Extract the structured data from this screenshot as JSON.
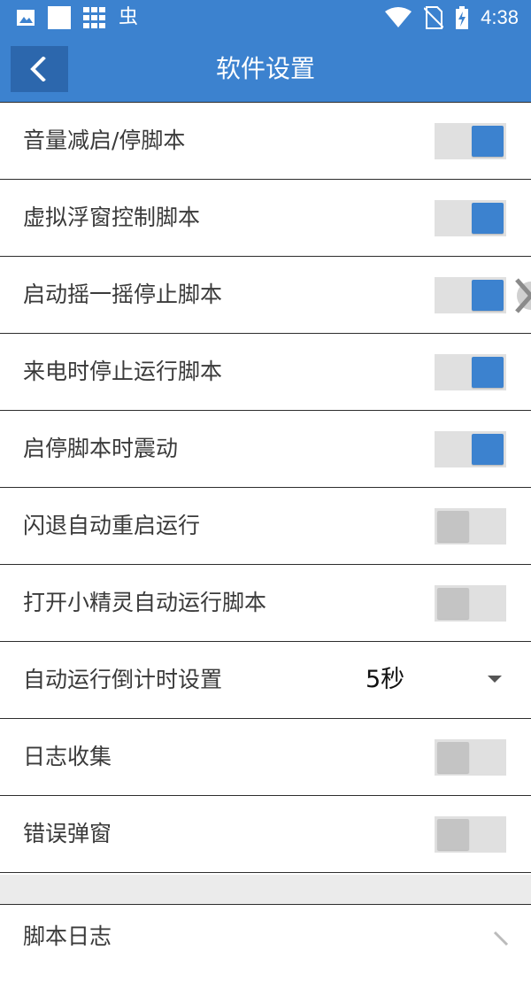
{
  "status_bar": {
    "time": "4:38",
    "icons": [
      "image-icon",
      "white-square-icon",
      "grid-icon",
      "bug-icon",
      "wifi-icon",
      "no-sim-icon",
      "battery-charging-icon"
    ]
  },
  "app_bar": {
    "title": "软件设置",
    "back_icon": "chevron-left-icon"
  },
  "colors": {
    "primary": "#3c82cf",
    "primary_dark": "#2c67ad",
    "switch_track": "#e0e0e0",
    "switch_knob_off": "#c4c4c4",
    "divider": "#2d2d2d",
    "section_gap": "#ebebeb"
  },
  "settings": [
    {
      "label": "音量减启/停脚本",
      "type": "switch",
      "on": true
    },
    {
      "label": "虚拟浮窗控制脚本",
      "type": "switch",
      "on": true
    },
    {
      "label": "启动摇一摇停止脚本",
      "type": "switch",
      "on": true
    },
    {
      "label": "来电时停止运行脚本",
      "type": "switch",
      "on": true
    },
    {
      "label": "启停脚本时震动",
      "type": "switch",
      "on": true
    },
    {
      "label": "闪退自动重启运行",
      "type": "switch",
      "on": false
    },
    {
      "label": "打开小精灵自动运行脚本",
      "type": "switch",
      "on": false
    },
    {
      "label": "自动运行倒计时设置",
      "type": "dropdown",
      "value": "5秒"
    },
    {
      "label": "日志收集",
      "type": "switch",
      "on": false
    },
    {
      "label": "错误弹窗",
      "type": "switch",
      "on": false
    }
  ],
  "log_row": {
    "label": "脚本日志",
    "icon": "chevron-right-icon"
  }
}
